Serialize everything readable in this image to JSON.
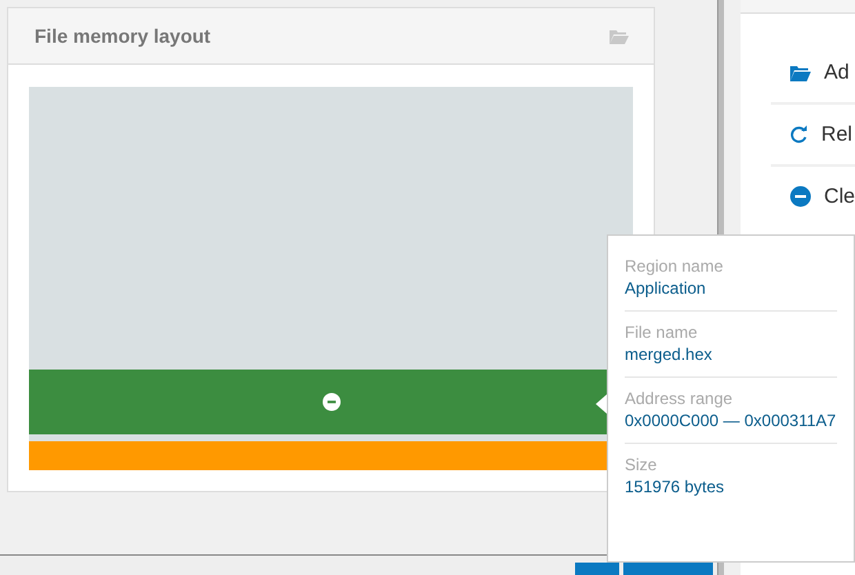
{
  "panel": {
    "title": "File memory layout"
  },
  "memory_map": {
    "regions": [
      {
        "kind": "free",
        "color": "#d9e0e2"
      },
      {
        "kind": "file",
        "color": "#3c8d40"
      },
      {
        "kind": "file",
        "color": "#ff9900"
      }
    ]
  },
  "actions": [
    {
      "kind": "open",
      "label": "Ad"
    },
    {
      "kind": "reload",
      "label": "Rel"
    },
    {
      "kind": "clear",
      "label": "Cle"
    }
  ],
  "tooltip": {
    "fields": [
      {
        "label": "Region name",
        "value": "Application"
      },
      {
        "label": "File name",
        "value": "merged.hex"
      },
      {
        "label": "Address range",
        "value": "0x0000C000 — 0x000311A7"
      },
      {
        "label": "Size",
        "value": "151976 bytes"
      }
    ]
  }
}
